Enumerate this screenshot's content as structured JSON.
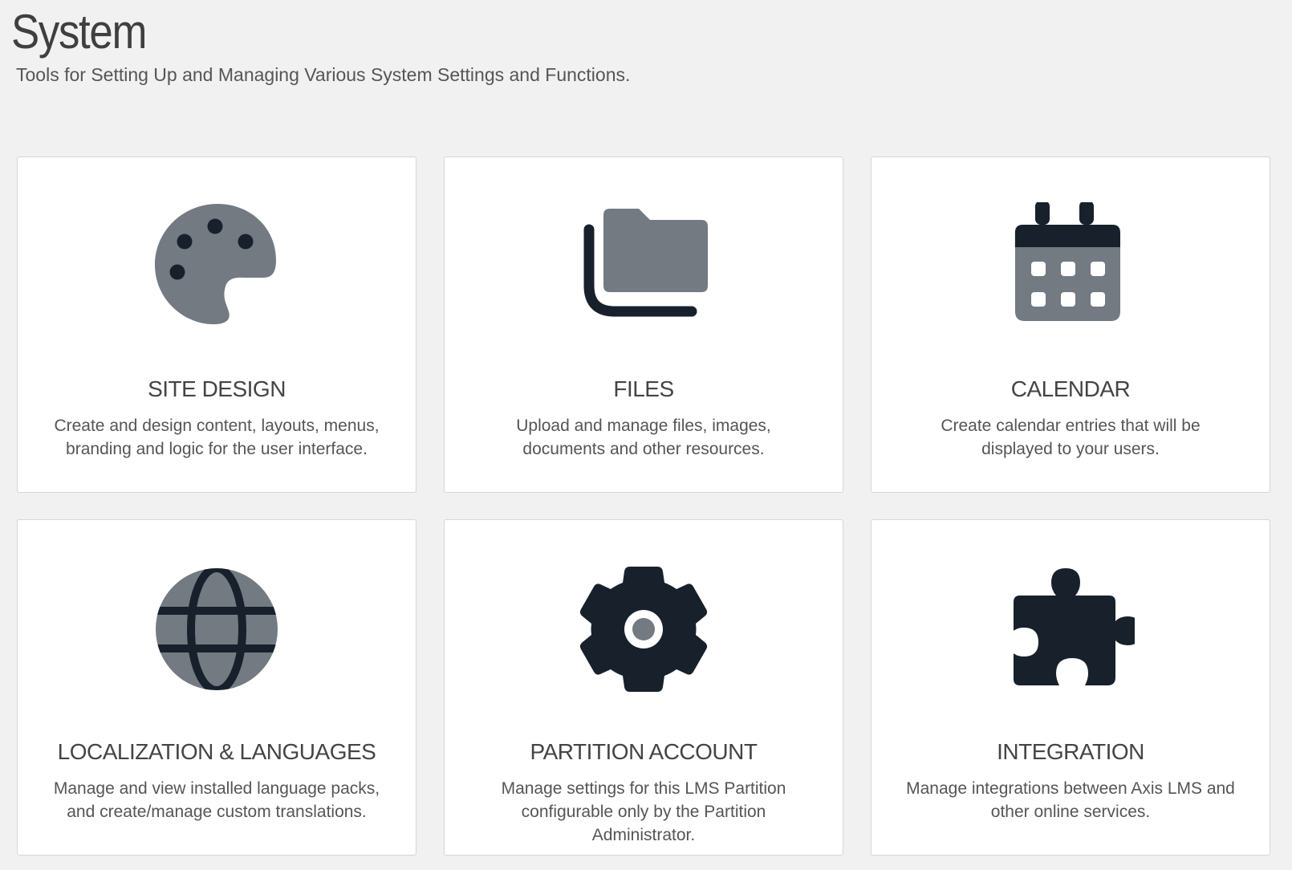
{
  "page": {
    "title": "System",
    "subtitle": "Tools for Setting Up and Managing Various System Settings and Functions."
  },
  "colors": {
    "background": "#f1f1f1",
    "icon_dark": "#18212b",
    "icon_gray": "#737a82",
    "card": "#ffffff"
  },
  "cards": [
    {
      "icon": "palette-icon",
      "title": "SITE DESIGN",
      "description": "Create and design content, layouts, menus, branding and logic for the user interface."
    },
    {
      "icon": "folder-icon",
      "title": "FILES",
      "description": "Upload and manage files, images, documents and other resources."
    },
    {
      "icon": "calendar-icon",
      "title": "CALENDAR",
      "description": "Create calendar entries that will be displayed to your users."
    },
    {
      "icon": "globe-icon",
      "title": "LOCALIZATION & LANGUAGES",
      "description": "Manage and view installed language packs, and create/manage custom translations."
    },
    {
      "icon": "gear-icon",
      "title": "PARTITION ACCOUNT",
      "description": "Manage settings for this LMS Partition configurable only by the Partition Administrator."
    },
    {
      "icon": "puzzle-icon",
      "title": "INTEGRATION",
      "description": "Manage integrations between Axis LMS and other online services."
    }
  ]
}
